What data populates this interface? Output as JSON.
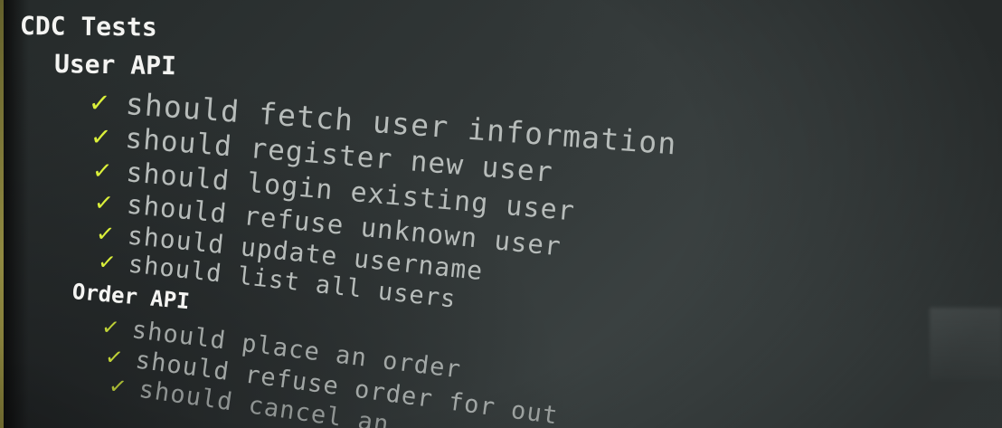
{
  "window": {
    "type": "terminal",
    "background": "#2f3434"
  },
  "colors": {
    "suite_text": "#f4f4f2",
    "test_text": "#b7bcba",
    "pass_check": "#dbf03a"
  },
  "terminal": {
    "root_title": "CDC Tests",
    "suites": [
      {
        "name": "User API",
        "tests": [
          {
            "status": "pass",
            "mark": "✓",
            "label": "should fetch user information"
          },
          {
            "status": "pass",
            "mark": "✓",
            "label": "should register new user"
          },
          {
            "status": "pass",
            "mark": "✓",
            "label": "should login existing user"
          },
          {
            "status": "pass",
            "mark": "✓",
            "label": "should refuse unknown user"
          },
          {
            "status": "pass",
            "mark": "✓",
            "label": "should update username"
          },
          {
            "status": "pass",
            "mark": "✓",
            "label": "should list all users"
          }
        ]
      },
      {
        "name": "Order API",
        "tests": [
          {
            "status": "pass",
            "mark": "✓",
            "label": "should place an order"
          },
          {
            "status": "pass",
            "mark": "✓",
            "label": "should refuse order for out"
          },
          {
            "status": "pass",
            "mark": "✓",
            "label": "should cancel an"
          }
        ]
      }
    ]
  }
}
